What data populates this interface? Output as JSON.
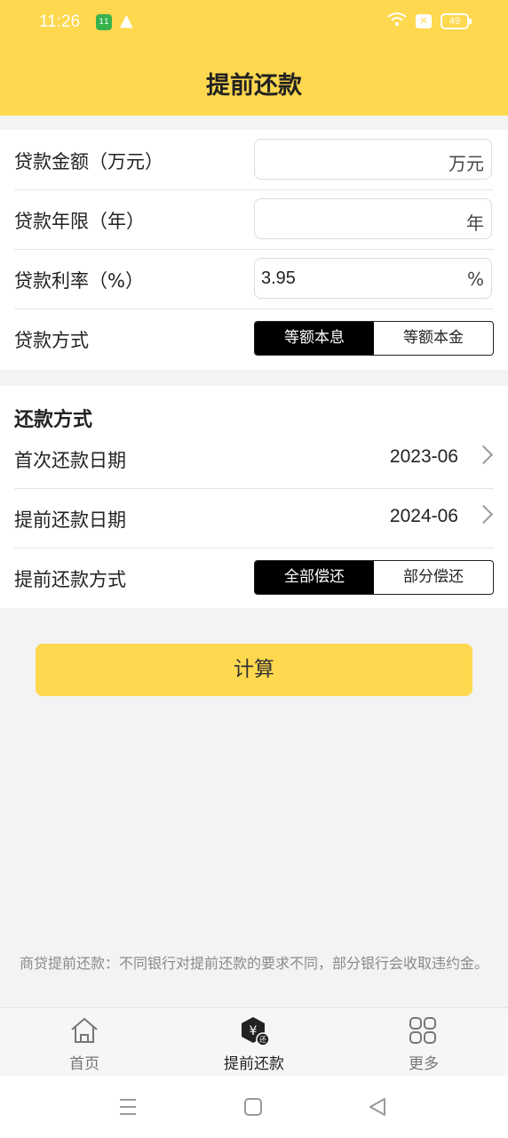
{
  "status": {
    "time": "11:26",
    "battery": "49"
  },
  "header": {
    "title": "提前还款"
  },
  "form": {
    "loan_amount_label": "贷款金额（万元）",
    "loan_amount_unit": "万元",
    "loan_years_label": "贷款年限（年）",
    "loan_years_unit": "年",
    "rate_label": "贷款利率（%）",
    "rate_value": "3.95",
    "rate_unit": "%",
    "method_label": "贷款方式",
    "method_options": [
      "等额本息",
      "等额本金"
    ],
    "method_selected": "等额本息"
  },
  "repay": {
    "section_title": "还款方式",
    "first_date_label": "首次还款日期",
    "first_date_value": "2023-06",
    "prepay_date_label": "提前还款日期",
    "prepay_date_value": "2024-06",
    "prepay_method_label": "提前还款方式",
    "prepay_options": [
      "全部偿还",
      "部分偿还"
    ],
    "prepay_selected": "全部偿还"
  },
  "calc_button": "计算",
  "note": "商贷提前还款：不同银行对提前还款的要求不同，部分银行会收取违约金。",
  "tabs": [
    {
      "label": "首页",
      "icon": "home-icon"
    },
    {
      "label": "提前还款",
      "icon": "yuan-repay-icon"
    },
    {
      "label": "更多",
      "icon": "grid-icon"
    }
  ],
  "colors": {
    "accent": "#fed84e",
    "selected": "#000000",
    "background": "#f3f3f3"
  }
}
